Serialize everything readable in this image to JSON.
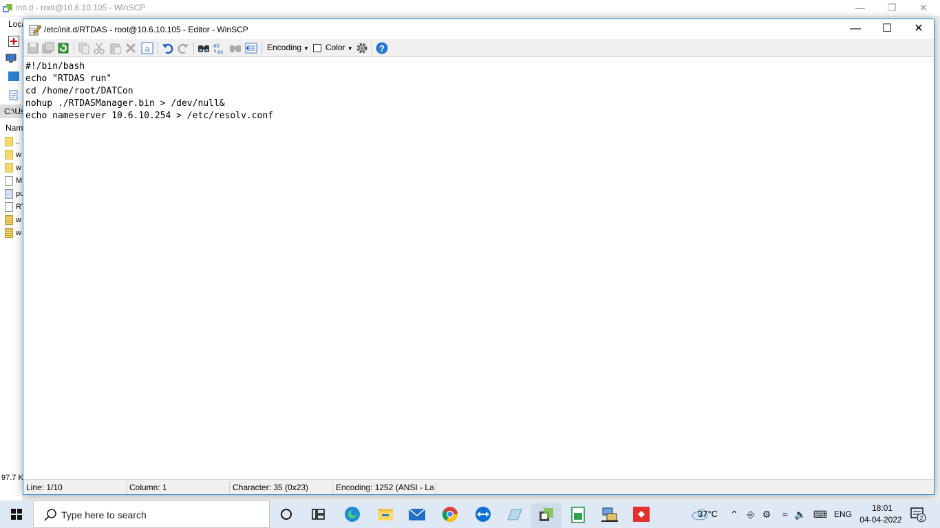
{
  "background_window": {
    "title": "init.d - root@10.6.10.105 - WinSCP",
    "local_label": "Loca",
    "path": "C:\\Us",
    "column_name": "Nam",
    "files": [
      {
        "name": "..",
        "icon": "folder-up-icon"
      },
      {
        "name": "w",
        "icon": "folder-icon"
      },
      {
        "name": "w",
        "icon": "folder-icon"
      },
      {
        "name": "M",
        "icon": "document-icon"
      },
      {
        "name": "pu",
        "icon": "key-file-icon"
      },
      {
        "name": "RT",
        "icon": "document-icon"
      },
      {
        "name": "w",
        "icon": "zip-icon"
      },
      {
        "name": "w",
        "icon": "zip-icon"
      }
    ],
    "size_text": "97.7 K"
  },
  "editor": {
    "title": "/etc/init.d/RTDAS - root@10.6.10.105 - Editor - WinSCP",
    "toolbar": {
      "encoding_label": "Encoding",
      "color_label": "Color"
    },
    "lines": [
      "#!/bin/bash",
      "echo \"RTDAS run\"",
      "cd /home/root/DATCon",
      "nohup ./RTDASManager.bin > /dev/null&",
      "echo nameserver 10.6.10.254 > /etc/resolv.conf"
    ],
    "status": {
      "line": "Line: 1/10",
      "column": "Column: 1",
      "character": "Character: 35 (0x23)",
      "encoding": "Encoding: 1252  (ANSI - La"
    }
  },
  "taskbar": {
    "search_placeholder": "Type here to search",
    "temperature": "37°C",
    "language": "ENG",
    "time": "18:01",
    "date": "04-04-2022",
    "notification_count": "2",
    "accent": "#2b79d0"
  }
}
